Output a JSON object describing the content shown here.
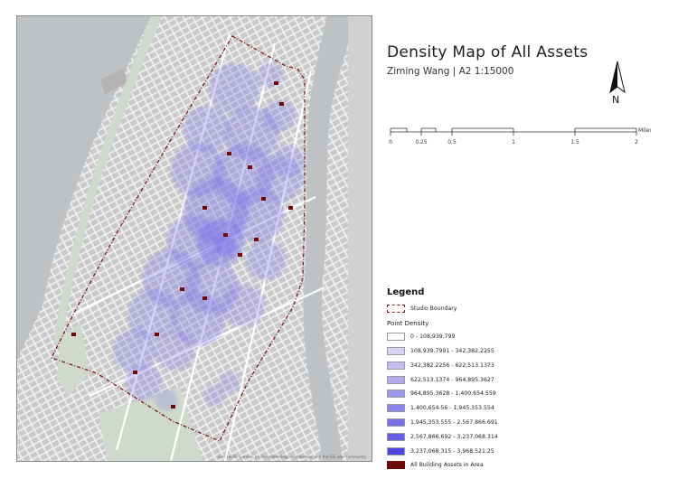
{
  "title": "Density Map of All Assets",
  "subtitle": "Ziming Wang | A2 1:15000",
  "north_label": "N",
  "scale": {
    "unit": "Miles",
    "ticks": [
      "0",
      "0.25",
      "0.5",
      "1",
      "1.5",
      "2"
    ]
  },
  "legend": {
    "title": "Legend",
    "boundary_label": "Studio Boundary",
    "density_title": "Point Density",
    "classes": [
      {
        "label": "0 - 108,939.799",
        "color": "#ffffff"
      },
      {
        "label": "108,939.7991 - 342,382.2255",
        "color": "#d9d4f6"
      },
      {
        "label": "342,382.2256 - 622,513.1373",
        "color": "#c4bdf2"
      },
      {
        "label": "622,513.1374 - 964,895.3627",
        "color": "#b2a9ef"
      },
      {
        "label": "964,895.3628 - 1,400,654.559",
        "color": "#a096ec"
      },
      {
        "label": "1,400,654.56 - 1,945,353.554",
        "color": "#8e83ea"
      },
      {
        "label": "1,945,353.555 - 2,567,866.691",
        "color": "#7b6fe8"
      },
      {
        "label": "2,567,866.692 - 3,237,068.314",
        "color": "#665be6"
      },
      {
        "label": "3,237,068.315 - 3,968,521.25",
        "color": "#4d42e4"
      }
    ],
    "assets_label": "All Building Assets in Area",
    "assets_color": "#6e0a0a"
  },
  "map": {
    "water_color": "#bfc2c4",
    "park_color": "#cfd9cc",
    "block_color": "#c9c9c9",
    "street_color": "#f2f2f2",
    "boundary_color": "#7a1a1a",
    "density_color": "#7b6fe8",
    "attribution": "Esri, HERE, Garmin, (c) OpenStreetMap contributors, and the GIS user community"
  }
}
